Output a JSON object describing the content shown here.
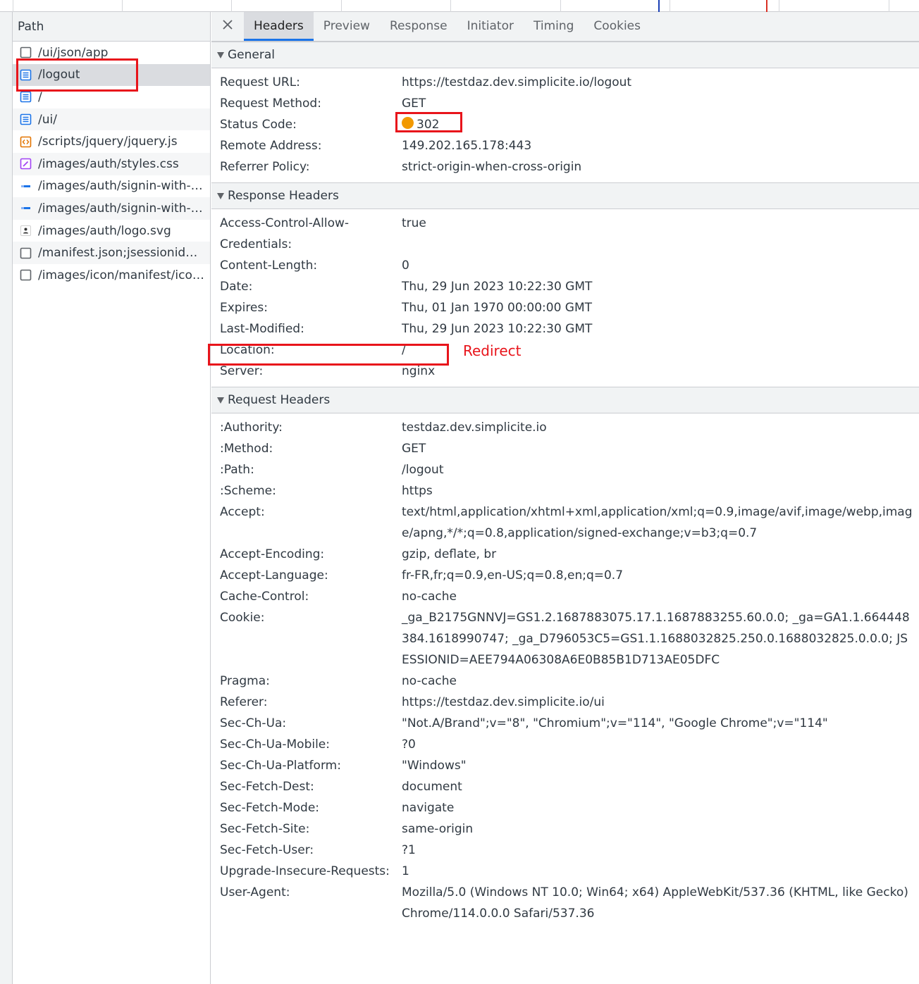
{
  "path_panel": {
    "header": "Path",
    "items": [
      {
        "label": "/ui/json/app",
        "icon": "other-file-icon"
      },
      {
        "label": "/logout",
        "icon": "document-icon"
      },
      {
        "label": "/",
        "icon": "document-icon"
      },
      {
        "label": "/ui/",
        "icon": "document-icon"
      },
      {
        "label": "/scripts/jquery/jquery.js",
        "icon": "script-icon"
      },
      {
        "label": "/images/auth/styles.css",
        "icon": "stylesheet-icon"
      },
      {
        "label": "/images/auth/signin-with-si...",
        "icon": "image-icon"
      },
      {
        "label": "/images/auth/signin-with-ld...",
        "icon": "image-icon"
      },
      {
        "label": "/images/auth/logo.svg",
        "icon": "svg-icon"
      },
      {
        "label": "/manifest.json;jsessionid=_S...",
        "icon": "other-file-icon"
      },
      {
        "label": "/images/icon/manifest/icon...",
        "icon": "other-file-icon"
      }
    ]
  },
  "tabs": {
    "close": "✕",
    "items": [
      "Headers",
      "Preview",
      "Response",
      "Initiator",
      "Timing",
      "Cookies"
    ],
    "active": "Headers"
  },
  "general": {
    "title": "General",
    "rows": [
      {
        "k": "Request URL:",
        "v": "https://testdaz.dev.simplicite.io/logout"
      },
      {
        "k": "Request Method:",
        "v": "GET"
      },
      {
        "k": "Status Code:",
        "v": "302"
      },
      {
        "k": "Remote Address:",
        "v": "149.202.165.178:443"
      },
      {
        "k": "Referrer Policy:",
        "v": "strict-origin-when-cross-origin"
      }
    ]
  },
  "response_headers": {
    "title": "Response Headers",
    "rows": [
      {
        "k": "Access-Control-Allow-Credentials:",
        "v": "true"
      },
      {
        "k": "Content-Length:",
        "v": "0"
      },
      {
        "k": "Date:",
        "v": "Thu, 29 Jun 2023 10:22:30 GMT"
      },
      {
        "k": "Expires:",
        "v": "Thu, 01 Jan 1970 00:00:00 GMT"
      },
      {
        "k": "Last-Modified:",
        "v": "Thu, 29 Jun 2023 10:22:30 GMT"
      },
      {
        "k": "Location:",
        "v": "/"
      },
      {
        "k": "Server:",
        "v": "nginx"
      }
    ]
  },
  "request_headers": {
    "title": "Request Headers",
    "rows": [
      {
        "k": ":Authority:",
        "v": "testdaz.dev.simplicite.io"
      },
      {
        "k": ":Method:",
        "v": "GET"
      },
      {
        "k": ":Path:",
        "v": "/logout"
      },
      {
        "k": ":Scheme:",
        "v": "https"
      },
      {
        "k": "Accept:",
        "v": "text/html,application/xhtml+xml,application/xml;q=0.9,image/avif,image/webp,image/apng,*/*;q=0.8,application/signed-exchange;v=b3;q=0.7"
      },
      {
        "k": "Accept-Encoding:",
        "v": "gzip, deflate, br"
      },
      {
        "k": "Accept-Language:",
        "v": "fr-FR,fr;q=0.9,en-US;q=0.8,en;q=0.7"
      },
      {
        "k": "Cache-Control:",
        "v": "no-cache"
      },
      {
        "k": "Cookie:",
        "v": "_ga_B2175GNNVJ=GS1.2.1687883075.17.1.1687883255.60.0.0; _ga=GA1.1.664448384.1618990747; _ga_D796053C5=GS1.1.1688032825.250.0.1688032825.0.0.0; JSESSIONID=AEE794A06308A6E0B85B1D713AE05DFC"
      },
      {
        "k": "Pragma:",
        "v": "no-cache"
      },
      {
        "k": "Referer:",
        "v": "https://testdaz.dev.simplicite.io/ui"
      },
      {
        "k": "Sec-Ch-Ua:",
        "v": "\"Not.A/Brand\";v=\"8\", \"Chromium\";v=\"114\", \"Google Chrome\";v=\"114\""
      },
      {
        "k": "Sec-Ch-Ua-Mobile:",
        "v": "?0"
      },
      {
        "k": "Sec-Ch-Ua-Platform:",
        "v": "\"Windows\""
      },
      {
        "k": "Sec-Fetch-Dest:",
        "v": "document"
      },
      {
        "k": "Sec-Fetch-Mode:",
        "v": "navigate"
      },
      {
        "k": "Sec-Fetch-Site:",
        "v": "same-origin"
      },
      {
        "k": "Sec-Fetch-User:",
        "v": "?1"
      },
      {
        "k": "Upgrade-Insecure-Requests:",
        "v": "1"
      },
      {
        "k": "User-Agent:",
        "v": "Mozilla/5.0 (Windows NT 10.0; Win64; x64) AppleWebKit/537.36 (KHTML, like Gecko) Chrome/114.0.0.0 Safari/537.36"
      }
    ]
  },
  "annotation": {
    "redirect_label": "Redirect",
    "color": "#e8141b"
  },
  "colors": {
    "status_dot": "#f29900",
    "active_tab_underline": "#1a73e8"
  }
}
